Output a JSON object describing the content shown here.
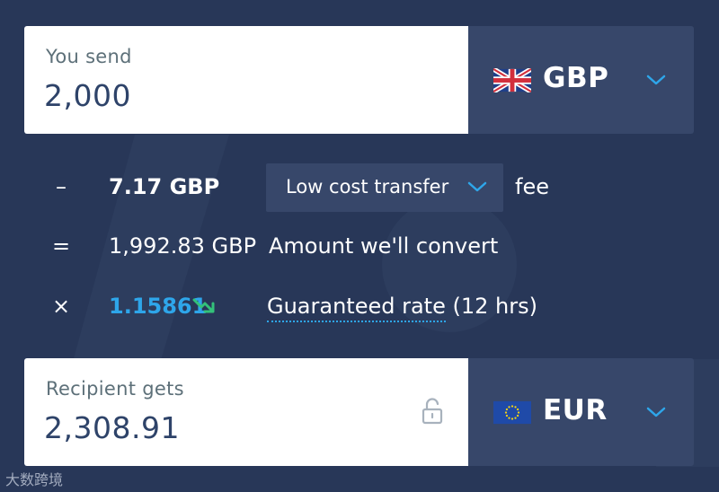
{
  "send": {
    "label": "You send",
    "value": "2,000",
    "currency": "GBP",
    "flag_icon": "uk-flag-icon"
  },
  "fee": {
    "operator": "–",
    "amount": "7.17 GBP",
    "option": "Low cost transfer",
    "suffix": "fee"
  },
  "convert": {
    "operator": "=",
    "amount": "1,992.83 GBP",
    "description": "Amount we'll convert"
  },
  "rate": {
    "operator": "×",
    "value": "1.15861",
    "trend_icon": "trend-down-icon",
    "link_text": "Guaranteed rate",
    "duration": "(12 hrs)"
  },
  "receive": {
    "label": "Recipient gets",
    "value": "2,308.91",
    "currency": "EUR",
    "flag_icon": "eu-flag-icon",
    "lock_icon": "unlock-icon"
  },
  "watermark": "大数跨境",
  "colors": {
    "background": "#283758",
    "panel": "#37476a",
    "accent": "#2ea6ea",
    "amount_text": "#2e4369",
    "label_text": "#5d7079",
    "trend": "#33c17a"
  }
}
